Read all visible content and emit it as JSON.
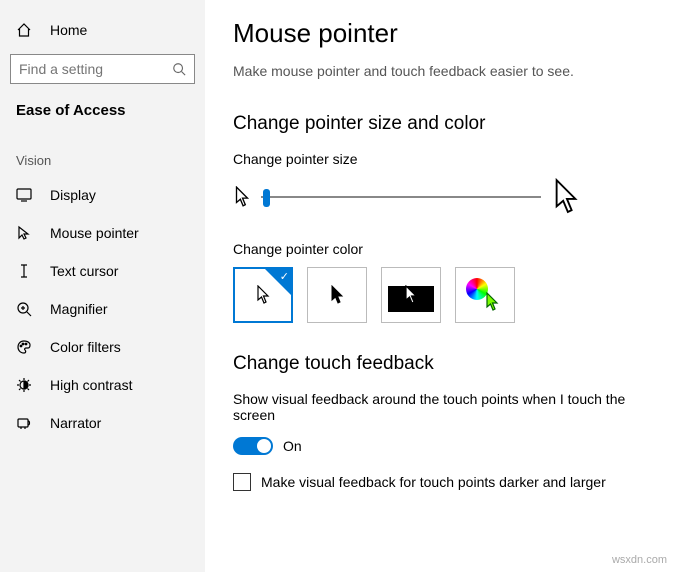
{
  "sidebar": {
    "home": "Home",
    "search_placeholder": "Find a setting",
    "category": "Ease of Access",
    "group": "Vision",
    "items": [
      {
        "label": "Display"
      },
      {
        "label": "Mouse pointer"
      },
      {
        "label": "Text cursor"
      },
      {
        "label": "Magnifier"
      },
      {
        "label": "Color filters"
      },
      {
        "label": "High contrast"
      },
      {
        "label": "Narrator"
      }
    ]
  },
  "main": {
    "title": "Mouse pointer",
    "description": "Make mouse pointer and touch feedback easier to see.",
    "section1_title": "Change pointer size and color",
    "size_label": "Change pointer size",
    "color_label": "Change pointer color",
    "section2_title": "Change touch feedback",
    "touch_desc": "Show visual feedback around the touch points when I touch the screen",
    "toggle_label": "On",
    "checkbox_label": "Make visual feedback for touch points darker and larger"
  },
  "watermark": "wsxdn.com"
}
